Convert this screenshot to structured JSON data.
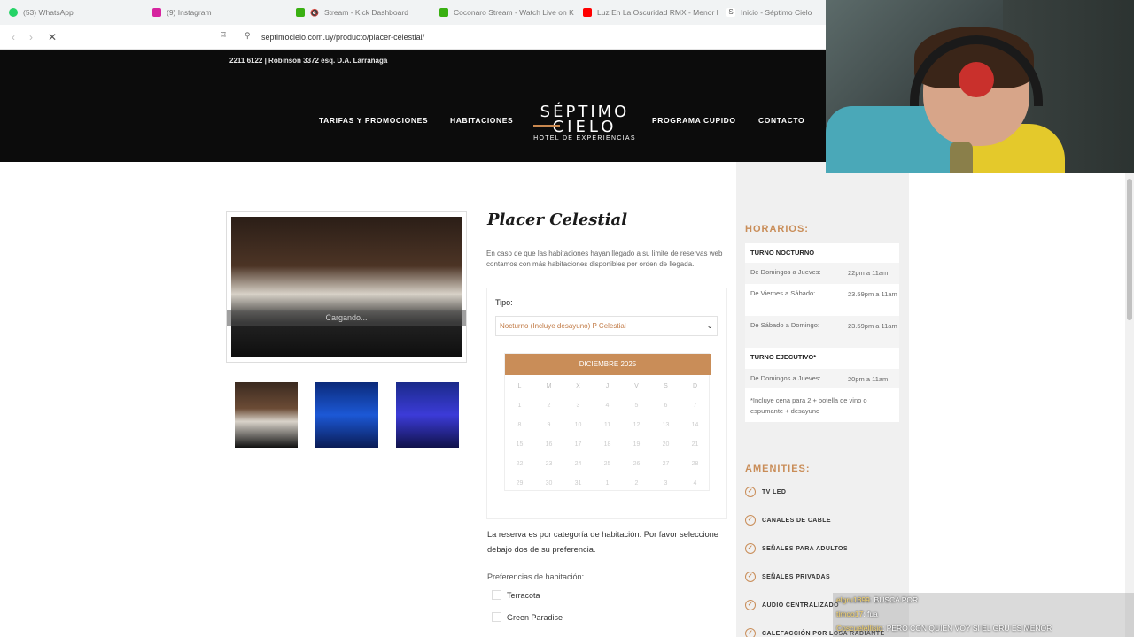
{
  "browser": {
    "tabs": [
      {
        "label": "(53) WhatsApp",
        "color": "#25d366"
      },
      {
        "label": "(9) Instagram",
        "color": "#d6249f"
      },
      {
        "label": "Stream - Kick Dashboard",
        "color": "#53fc18"
      },
      {
        "label": "Coconaro Stream - Watch Live on Ki",
        "color": "#53fc18"
      },
      {
        "label": "Luz En La Oscuridad RMX - Menor F",
        "color": "#ff0000"
      },
      {
        "label": "Inicio - Séptimo Cielo",
        "color": "#555555"
      }
    ],
    "url": "septimocielo.com.uy/producto/placer-celestial/"
  },
  "site": {
    "contact_line": "2211 6122 | Robinson 3372 esq. D.A. Larrañaga",
    "nav": {
      "tarifas": "TARIFAS Y PROMOCIONES",
      "habitaciones": "HABITACIONES",
      "programa": "PROGRAMA CUPIDO",
      "contacto": "CONTACTO"
    },
    "logo": {
      "line1": "SÉPTIMO",
      "line2": "CIELO",
      "line3": "HOTEL DE EXPERIENCIAS"
    }
  },
  "product": {
    "loading": "Cargando...",
    "title": "Placer Celestial",
    "intro": "En caso de que las habitaciones hayan llegado a su limite de reservas web contamos con más habitaciones disponibles por orden de llegada.",
    "tipo_label": "Tipo:",
    "tipo_value": "Nocturno (Incluye desayuno) P Celestial",
    "calendar": {
      "month": "DICIEMBRE 2025",
      "dow": [
        "L",
        "M",
        "X",
        "J",
        "V",
        "S",
        "D"
      ],
      "weeks": [
        [
          "1",
          "2",
          "3",
          "4",
          "5",
          "6",
          "7"
        ],
        [
          "8",
          "9",
          "10",
          "11",
          "12",
          "13",
          "14"
        ],
        [
          "15",
          "16",
          "17",
          "18",
          "19",
          "20",
          "21"
        ],
        [
          "22",
          "23",
          "24",
          "25",
          "26",
          "27",
          "28"
        ],
        [
          "29",
          "30",
          "31",
          "1",
          "2",
          "3",
          "4"
        ]
      ]
    },
    "note": "La reserva es por categoría de habitación. Por favor seleccione debajo dos de su preferencia.",
    "pref_label": "Preferencias de habitación:",
    "prefs": [
      "Terracota",
      "Green Paradise"
    ]
  },
  "sidebar": {
    "horarios_title": "HORARIOS:",
    "turno_nocturno": "TURNO NOCTURNO",
    "rows_nocturno": [
      {
        "day": "De Domingos a Jueves:",
        "time": "22pm a 11am"
      },
      {
        "day": "De Viernes a Sábado:",
        "time": "23.59pm a 11am"
      },
      {
        "day": "De Sábado a Domingo:",
        "time": "23.59pm a 11am"
      }
    ],
    "turno_ejecutivo": "TURNO EJECUTIVO*",
    "row_ejecutivo": {
      "day": "De Domingos a Jueves:",
      "time": "20pm a 11am"
    },
    "ejecutivo_note": "*Incluye cena para 2 + botella de vino o espumante + desayuno",
    "amenities_title": "AMENITIES:",
    "amenities": [
      "TV LED",
      "CANALES DE CABLE",
      "SEÑALES PARA ADULTOS",
      "SEÑALES PRIVADAS",
      "AUDIO CENTRALIZADO",
      "CALEFACCIÓN POR LOSA RADIANTE"
    ]
  },
  "chat": [
    {
      "user": "elgru1899",
      "msg": ": BUSCA POR"
    },
    {
      "user": "timoo17",
      "msg": ": fua"
    },
    {
      "user": "Coscuelellisio",
      "msg": ": PERO CON QUIEN VOY SI EL GRU ES MENOR"
    }
  ]
}
